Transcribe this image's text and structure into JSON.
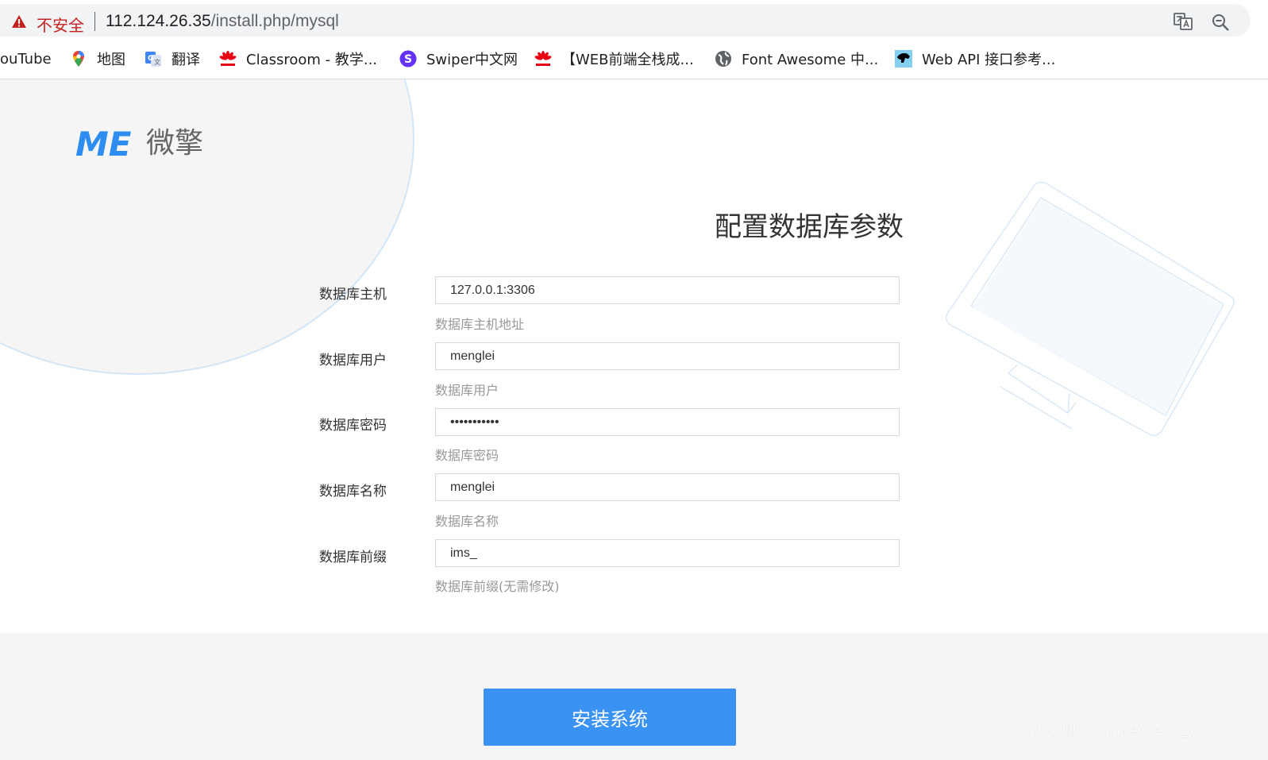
{
  "browser": {
    "security_label": "不安全",
    "url_host": "112.124.26.35",
    "url_path": "/install.php/mysql",
    "icons": [
      "warning-icon",
      "translate-icon",
      "zoom-out-icon"
    ],
    "colors": {
      "warning": "#c5221f",
      "omnibox_bg": "#f1f3f4"
    }
  },
  "bookmarks": [
    {
      "label": "ouTube",
      "icon": "youtube-icon"
    },
    {
      "label": "地图",
      "icon": "google-maps-icon"
    },
    {
      "label": "翻译",
      "icon": "google-translate-icon"
    },
    {
      "label": "Classroom - 教学...",
      "icon": "huawei-icon"
    },
    {
      "label": "Swiper中文网",
      "icon": "swiper-icon"
    },
    {
      "label": "【WEB前端全栈成...",
      "icon": "huawei-icon"
    },
    {
      "label": "Font Awesome 中...",
      "icon": "globe-icon"
    },
    {
      "label": "Web API 接口参考...",
      "icon": "mdn-icon"
    }
  ],
  "logo": {
    "mark": "ME",
    "text": "微擎"
  },
  "form": {
    "title": "配置数据库参数",
    "fields": [
      {
        "label": "数据库主机",
        "value": "127.0.0.1:3306",
        "hint": "数据库主机地址",
        "type": "text"
      },
      {
        "label": "数据库用户",
        "value": "menglei",
        "hint": "数据库用户",
        "type": "text"
      },
      {
        "label": "数据库密码",
        "value": "•••••••••••",
        "hint": "数据库密码",
        "type": "password"
      },
      {
        "label": "数据库名称",
        "value": "menglei",
        "hint": "数据库名称",
        "type": "text"
      },
      {
        "label": "数据库前缀",
        "value": "ims_",
        "hint": "数据库前缀(无需修改)",
        "type": "text"
      }
    ]
  },
  "footer": {
    "install_label": "安装系统",
    "watermark": "https://blog.csdn.net/weixin_44407701"
  },
  "colors": {
    "primary": "#3a93f3",
    "logo_blue": "#2e8df0",
    "hint": "#999999",
    "footer_bg": "#f5f5f5"
  }
}
